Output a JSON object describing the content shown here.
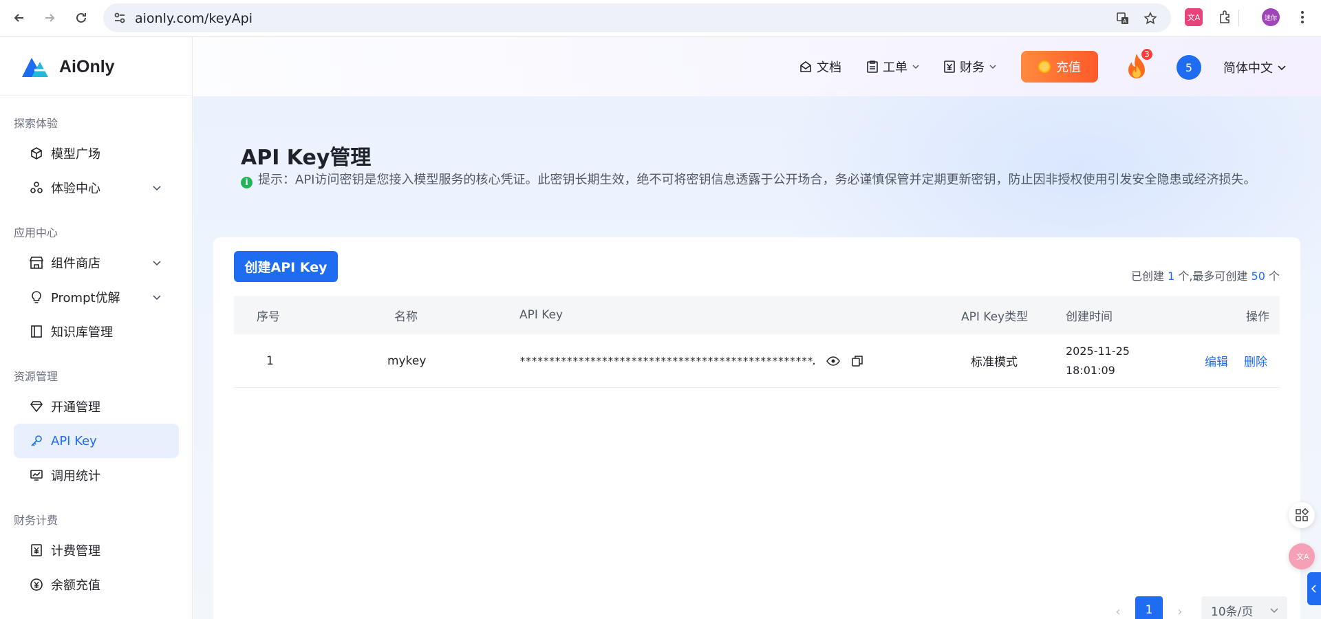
{
  "browser": {
    "url": "aionly.com/keyApi",
    "profile_label": "迷你",
    "ext_label": "文A"
  },
  "brand": {
    "name": "AiOnly"
  },
  "sidebar": {
    "groups": [
      {
        "label": "探索体验"
      },
      {
        "label": "应用中心"
      },
      {
        "label": "资源管理"
      },
      {
        "label": "财务计费"
      }
    ],
    "items": [
      {
        "label": "模型广场"
      },
      {
        "label": "体验中心"
      },
      {
        "label": "组件商店"
      },
      {
        "label": "Prompt优解"
      },
      {
        "label": "知识库管理"
      },
      {
        "label": "开通管理"
      },
      {
        "label": "API Key"
      },
      {
        "label": "调用统计"
      },
      {
        "label": "计费管理"
      },
      {
        "label": "余额充值"
      }
    ]
  },
  "header": {
    "docs": "文档",
    "ticket": "工单",
    "finance": "财务",
    "recharge": "充值",
    "fire_badge": "3",
    "avatar": "5",
    "language": "简体中文"
  },
  "page": {
    "title": "API Key管理",
    "tip": "提示：API访问密钥是您接入模型服务的核心凭证。此密钥长期生效，绝不可将密钥信息透露于公开场合，务必谨慎保管并定期更新密钥，防止因非授权使用引发安全隐患或经济损失。"
  },
  "card": {
    "create_button": "创建API Key",
    "quota_prefix": "已创建",
    "quota_created": "1",
    "quota_middle": "个,最多可创建",
    "quota_max": "50",
    "quota_suffix": "个"
  },
  "table": {
    "headers": {
      "index": "序号",
      "name": "名称",
      "key": "API Key",
      "type": "API Key类型",
      "created": "创建时间",
      "actions": "操作"
    },
    "rows": [
      {
        "index": "1",
        "name": "mykey",
        "key": "**************************************************…",
        "type": "标准模式",
        "created_date": "2025-11-25",
        "created_time": "18:01:09",
        "edit": "编辑",
        "delete": "删除"
      }
    ]
  },
  "pagination": {
    "current_page": "1",
    "page_size": "10条/页"
  },
  "colors": {
    "primary": "#1e6cf2",
    "recharge": "#ff6a2f",
    "tip_green": "#25b35a"
  }
}
